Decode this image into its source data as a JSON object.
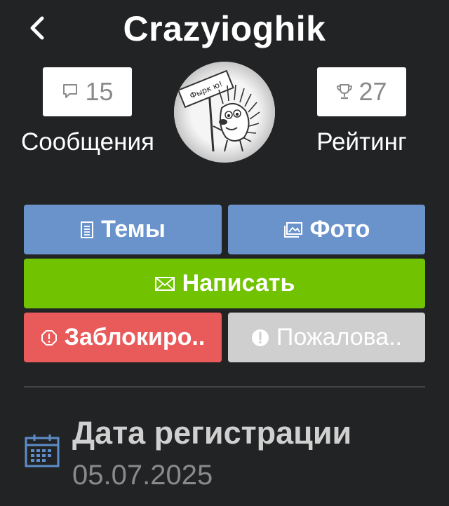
{
  "header": {
    "title": "Crazyioghik"
  },
  "stats": {
    "messages": {
      "count": "15",
      "label": "Сообщения",
      "icon": "speech-bubble-icon"
    },
    "rating": {
      "count": "27",
      "label": "Рейтинг",
      "icon": "trophy-icon"
    }
  },
  "avatar": {
    "sign_text": "Фырк ю!"
  },
  "actions": {
    "topics_label": "Темы",
    "photo_label": "Фото",
    "write_label": "Написать",
    "block_label": "Заблокиро..",
    "report_label": "Пожалова.."
  },
  "info": {
    "registration_label": "Дата регистрации",
    "registration_date": "05.07.2025"
  },
  "colors": {
    "background": "#222324",
    "blue_button": "#6a93cc",
    "green_button": "#71c301",
    "red_button": "#e95b5b",
    "grey_button": "#cfcfcf",
    "calendar_icon": "#5d8dc8"
  }
}
